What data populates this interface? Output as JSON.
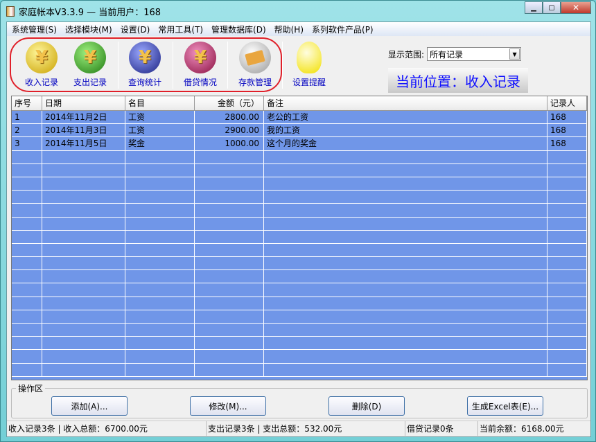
{
  "window": {
    "title": "家庭帐本V3.3.9 — 当前用户：168",
    "controls": [
      "minimize",
      "maximize",
      "close"
    ]
  },
  "menu": [
    "系统管理(S)",
    "选择模块(M)",
    "设置(D)",
    "常用工具(T)",
    "管理数据库(D)",
    "帮助(H)",
    "系列软件产品(P)"
  ],
  "toolbar": {
    "items": [
      {
        "label": "收入记录",
        "icon": "yen-income-icon",
        "color": "#d8b400"
      },
      {
        "label": "支出记录",
        "icon": "yen-expense-icon",
        "color": "#2f9a1a"
      },
      {
        "label": "查询统计",
        "icon": "yen-search-icon",
        "color": "#2a3aa0"
      },
      {
        "label": "借贷情况",
        "icon": "yen-loan-icon",
        "color": "#b0205a"
      },
      {
        "label": "存款管理",
        "icon": "bank-card-icon",
        "color": "#c8c8c8"
      },
      {
        "label": "设置提醒",
        "icon": "lightbulb-icon",
        "color": "#fff200"
      }
    ],
    "range_label": "显示范围:",
    "range_value": "所有记录",
    "position": "当前位置：收入记录"
  },
  "table": {
    "columns": [
      "序号",
      "日期",
      "名目",
      "金额（元）",
      "备注",
      "记录人"
    ],
    "rows": [
      [
        "1",
        "2014年11月2日",
        "工资",
        "2800.00",
        "老公的工资",
        "168"
      ],
      [
        "2",
        "2014年11月3日",
        "工资",
        "2900.00",
        "我的工资",
        "168"
      ],
      [
        "3",
        "2014年11月5日",
        "奖金",
        "1000.00",
        "这个月的奖金",
        "168"
      ]
    ]
  },
  "ops": {
    "label": "操作区",
    "buttons": [
      "添加(A)...",
      "修改(M)...",
      "删除(D)",
      "生成Excel表(E)..."
    ]
  },
  "status": [
    "收入记录3条 | 收入总额：6700.00元",
    "支出记录3条 | 支出总额：532.00元",
    "借贷记录0条",
    "当前余额：6168.00元"
  ]
}
